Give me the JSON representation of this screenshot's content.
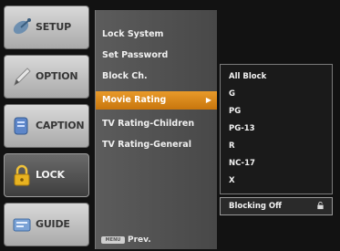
{
  "sidebar": {
    "items": [
      {
        "label": "SETUP",
        "icon": "satellite-icon"
      },
      {
        "label": "OPTION",
        "icon": "pencil-icon"
      },
      {
        "label": "CAPTION",
        "icon": "caption-icon"
      },
      {
        "label": "LOCK",
        "icon": "lock-icon",
        "active": true
      },
      {
        "label": "GUIDE",
        "icon": "guide-icon"
      }
    ]
  },
  "menu": {
    "items": [
      {
        "label": "Lock System"
      },
      {
        "label": "Set Password"
      },
      {
        "label": "Block Ch."
      },
      {
        "label": "Movie Rating",
        "highlighted": true,
        "arrow": "▶"
      },
      {
        "label": "TV Rating-Children"
      },
      {
        "label": "TV Rating-General"
      }
    ],
    "footer": {
      "key_label": "MENU",
      "label": "Prev."
    }
  },
  "ratings": {
    "items": [
      "All Block",
      "G",
      "PG",
      "PG-13",
      "R",
      "NC-17",
      "X"
    ]
  },
  "blocking": {
    "label": "Blocking Off"
  },
  "colors": {
    "highlight": "#d9861a",
    "active_sidebar": "#4f4f4f",
    "panel": "#525252"
  }
}
